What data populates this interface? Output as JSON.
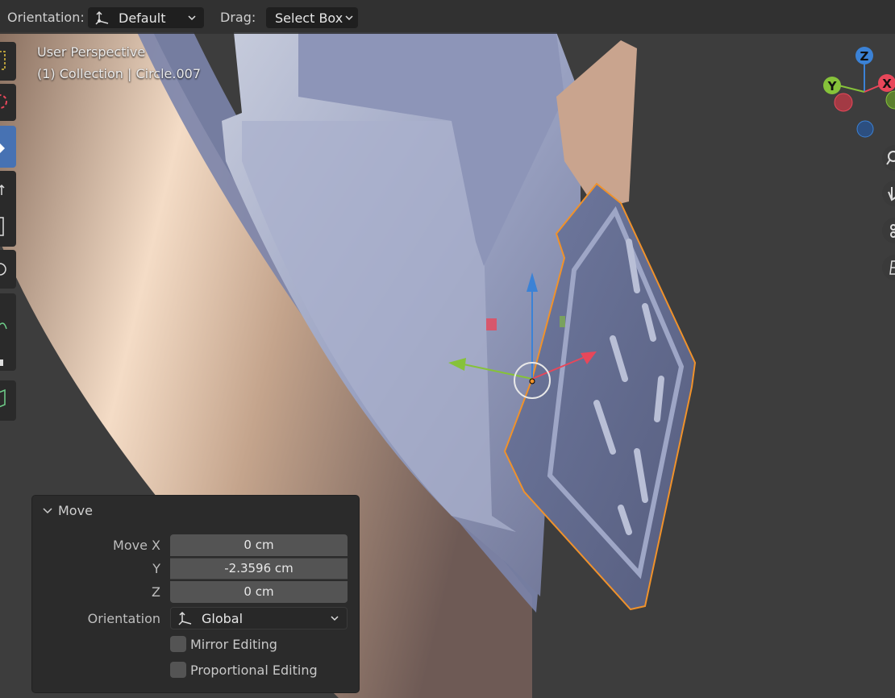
{
  "header": {
    "orientation_label": "Orientation:",
    "orientation_value": "Default",
    "drag_label": "Drag:",
    "drag_value": "Select Box"
  },
  "viewport": {
    "perspective": "User Perspective",
    "collection": "(1) Collection | Circle.007"
  },
  "gizmo": {
    "z": "Z",
    "y": "Y",
    "x": "X"
  },
  "operator_panel": {
    "title": "Move",
    "move_x_label": "Move X",
    "move_x_value": "0 cm",
    "y_label": "Y",
    "y_value": "-2.3596 cm",
    "z_label": "Z",
    "z_value": "0 cm",
    "orientation_label": "Orientation",
    "orientation_value": "Global",
    "mirror_label": "Mirror Editing",
    "proportional_label": "Proportional Editing"
  },
  "colors": {
    "selection_outline": "#f0922b",
    "active_tool": "#4772b3",
    "axis_x": "#e8475a",
    "axis_y": "#86c23a",
    "axis_z": "#3b82d6"
  }
}
